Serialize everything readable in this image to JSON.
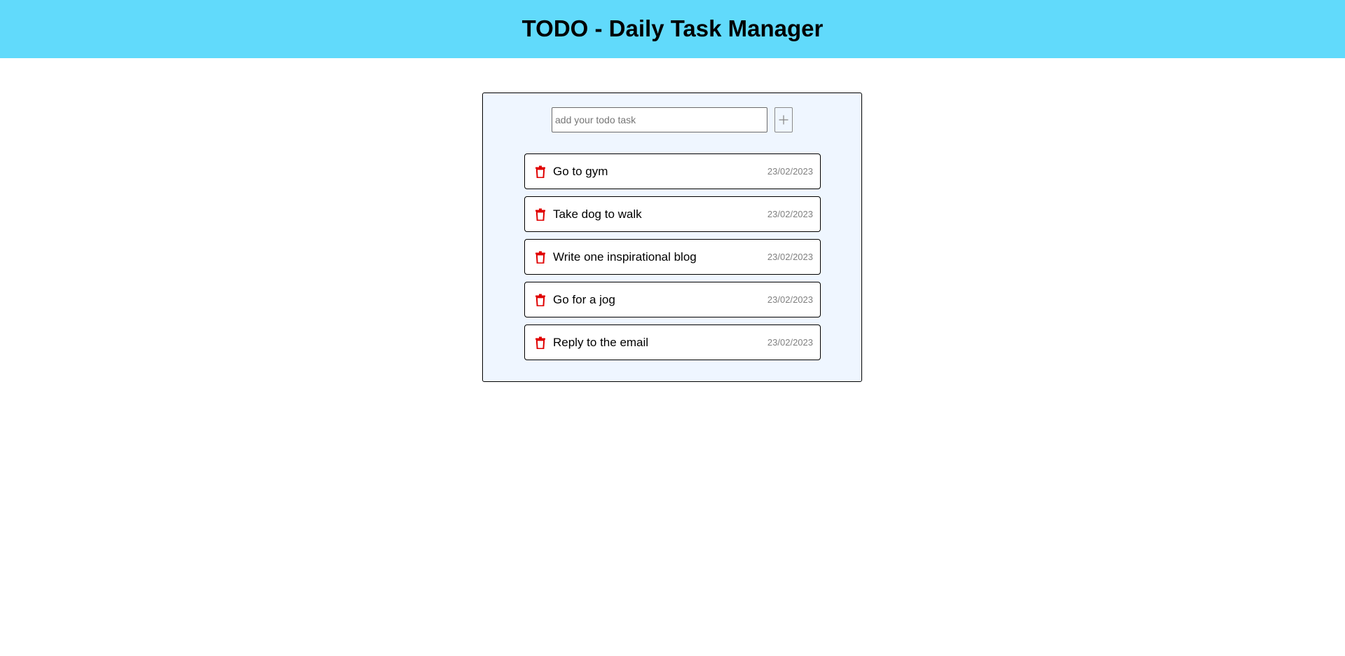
{
  "header": {
    "title": "TODO - Daily Task Manager"
  },
  "add_form": {
    "input_placeholder": "add your todo task",
    "input_value": "",
    "add_icon": "plus-icon"
  },
  "tasks": [
    {
      "text": "Go to gym",
      "date": "23/02/2023",
      "icon": "trash-icon"
    },
    {
      "text": "Take dog to walk",
      "date": "23/02/2023",
      "icon": "trash-icon"
    },
    {
      "text": "Write one inspirational blog",
      "date": "23/02/2023",
      "icon": "trash-icon"
    },
    {
      "text": "Go for a jog",
      "date": "23/02/2023",
      "icon": "trash-icon"
    },
    {
      "text": "Reply to the email",
      "date": "23/02/2023",
      "icon": "trash-icon"
    }
  ],
  "colors": {
    "header_bg": "#61dafb",
    "panel_bg": "#eff6ff",
    "delete_icon": "#e00000",
    "date_text": "#808080"
  }
}
